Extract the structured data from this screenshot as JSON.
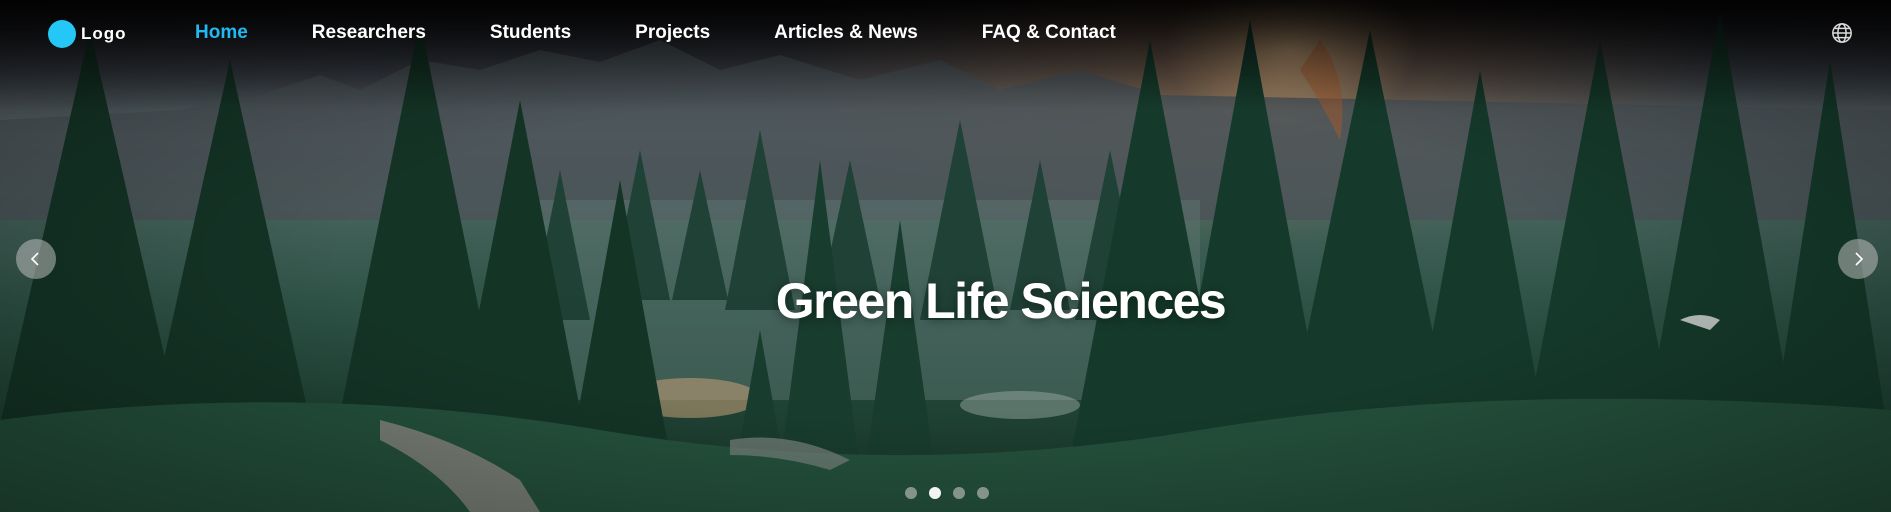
{
  "brand": {
    "logo_label": "Logo",
    "accent_color": "#25c7f7"
  },
  "nav": {
    "items": [
      {
        "label": "Home",
        "active": true
      },
      {
        "label": "Researchers",
        "active": false
      },
      {
        "label": "Students",
        "active": false
      },
      {
        "label": "Projects",
        "active": false
      },
      {
        "label": "Articles & News",
        "active": false
      },
      {
        "label": "FAQ & Contact",
        "active": false
      }
    ],
    "language_icon": "globe-icon"
  },
  "hero": {
    "title": "Green Life Sciences",
    "prev_icon": "chevron-left-icon",
    "next_icon": "chevron-right-icon",
    "slides_total": 4,
    "active_slide": 2
  }
}
